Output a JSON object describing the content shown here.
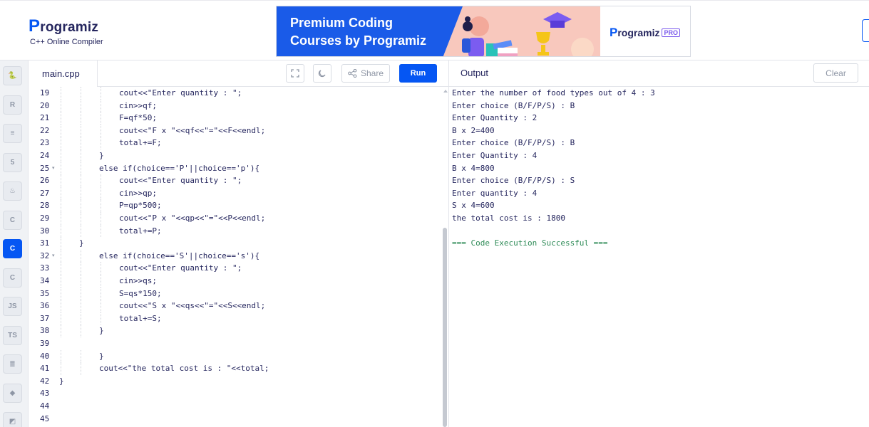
{
  "header": {
    "logo_text": "rogramiz",
    "logo_letter": "P",
    "subtitle": "C++ Online Compiler",
    "ad": {
      "line1": "Premium Coding",
      "line2": "Courses by Programiz",
      "brand_letter": "P",
      "brand_text": "rogramiz",
      "pro_badge": "PRO"
    }
  },
  "sidebar": {
    "languages": [
      {
        "icon": "python-icon",
        "glyph": "🐍",
        "active": false
      },
      {
        "icon": "r-icon",
        "glyph": "R",
        "active": false
      },
      {
        "icon": "sql-icon",
        "glyph": "≡",
        "active": false
      },
      {
        "icon": "html-icon",
        "glyph": "5",
        "active": false
      },
      {
        "icon": "java-icon",
        "glyph": "♨",
        "active": false
      },
      {
        "icon": "c-icon",
        "glyph": "C",
        "active": false
      },
      {
        "icon": "cpp-icon",
        "glyph": "C",
        "active": true
      },
      {
        "icon": "csharp-icon",
        "glyph": "C",
        "active": false
      },
      {
        "icon": "javascript-icon",
        "glyph": "JS",
        "active": false
      },
      {
        "icon": "typescript-icon",
        "glyph": "TS",
        "active": false
      },
      {
        "icon": "swift-icon",
        "glyph": "≣",
        "active": false
      },
      {
        "icon": "go-icon",
        "glyph": "◆",
        "active": false
      },
      {
        "icon": "php-icon",
        "glyph": "◩",
        "active": false
      }
    ]
  },
  "editor": {
    "file_tab": "main.cpp",
    "share_label": "Share",
    "run_label": "Run",
    "lines": [
      {
        "n": "19",
        "fold": "",
        "indent": 3,
        "text": "cout<<\"Enter quantity : \";"
      },
      {
        "n": "20",
        "fold": "",
        "indent": 3,
        "text": "cin>>qf;"
      },
      {
        "n": "21",
        "fold": "",
        "indent": 3,
        "text": "F=qf*50;"
      },
      {
        "n": "22",
        "fold": "",
        "indent": 3,
        "text": "cout<<\"F x \"<<qf<<\"=\"<<F<<endl;"
      },
      {
        "n": "23",
        "fold": "",
        "indent": 3,
        "text": "total+=F;"
      },
      {
        "n": "24",
        "fold": "",
        "indent": 2,
        "text": "}"
      },
      {
        "n": "25",
        "fold": "▾",
        "indent": 2,
        "text": "else if(choice=='P'||choice=='p'){"
      },
      {
        "n": "26",
        "fold": "",
        "indent": 3,
        "text": "cout<<\"Enter quantity : \";"
      },
      {
        "n": "27",
        "fold": "",
        "indent": 3,
        "text": "cin>>qp;"
      },
      {
        "n": "28",
        "fold": "",
        "indent": 3,
        "text": "P=qp*500;"
      },
      {
        "n": "29",
        "fold": "",
        "indent": 3,
        "text": "cout<<\"P x \"<<qp<<\"=\"<<P<<endl;"
      },
      {
        "n": "30",
        "fold": "",
        "indent": 3,
        "text": "total+=P;"
      },
      {
        "n": "31",
        "fold": "",
        "indent": 1,
        "text": "}"
      },
      {
        "n": "32",
        "fold": "▾",
        "indent": 2,
        "text": "else if(choice=='S'||choice=='s'){"
      },
      {
        "n": "33",
        "fold": "",
        "indent": 3,
        "text": "cout<<\"Enter quantity : \";"
      },
      {
        "n": "34",
        "fold": "",
        "indent": 3,
        "text": "cin>>qs;"
      },
      {
        "n": "35",
        "fold": "",
        "indent": 3,
        "text": "S=qs*150;"
      },
      {
        "n": "36",
        "fold": "",
        "indent": 3,
        "text": "cout<<\"S x \"<<qs<<\"=\"<<S<<endl;"
      },
      {
        "n": "37",
        "fold": "",
        "indent": 3,
        "text": "total+=S;"
      },
      {
        "n": "38",
        "fold": "",
        "indent": 2,
        "text": "}"
      },
      {
        "n": "39",
        "fold": "",
        "indent": 0,
        "text": ""
      },
      {
        "n": "40",
        "fold": "",
        "indent": 2,
        "text": "}"
      },
      {
        "n": "41",
        "fold": "",
        "indent": 2,
        "text": "cout<<\"the total cost is : \"<<total;"
      },
      {
        "n": "42",
        "fold": "",
        "indent": 0,
        "text": "}"
      },
      {
        "n": "43",
        "fold": "",
        "indent": 0,
        "text": ""
      },
      {
        "n": "44",
        "fold": "",
        "indent": 0,
        "text": ""
      },
      {
        "n": "45",
        "fold": "",
        "indent": 0,
        "text": ""
      }
    ]
  },
  "output": {
    "title": "Output",
    "clear_label": "Clear",
    "lines": [
      "Enter the number of food types out of 4 : 3",
      "Enter choice (B/F/P/S) : B",
      "Enter Quantity : 2",
      "B x 2=400",
      "Enter choice (B/F/P/S) : B",
      "Enter Quantity : 4",
      "B x 4=800",
      "Enter choice (B/F/P/S) : S",
      "Enter quantity : 4",
      "S x 4=600",
      "the total cost is : 1800",
      "",
      "=== Code Execution Successful ==="
    ]
  },
  "colors": {
    "accent": "#0556f3",
    "text": "#25265e",
    "success": "#2e8b57"
  }
}
